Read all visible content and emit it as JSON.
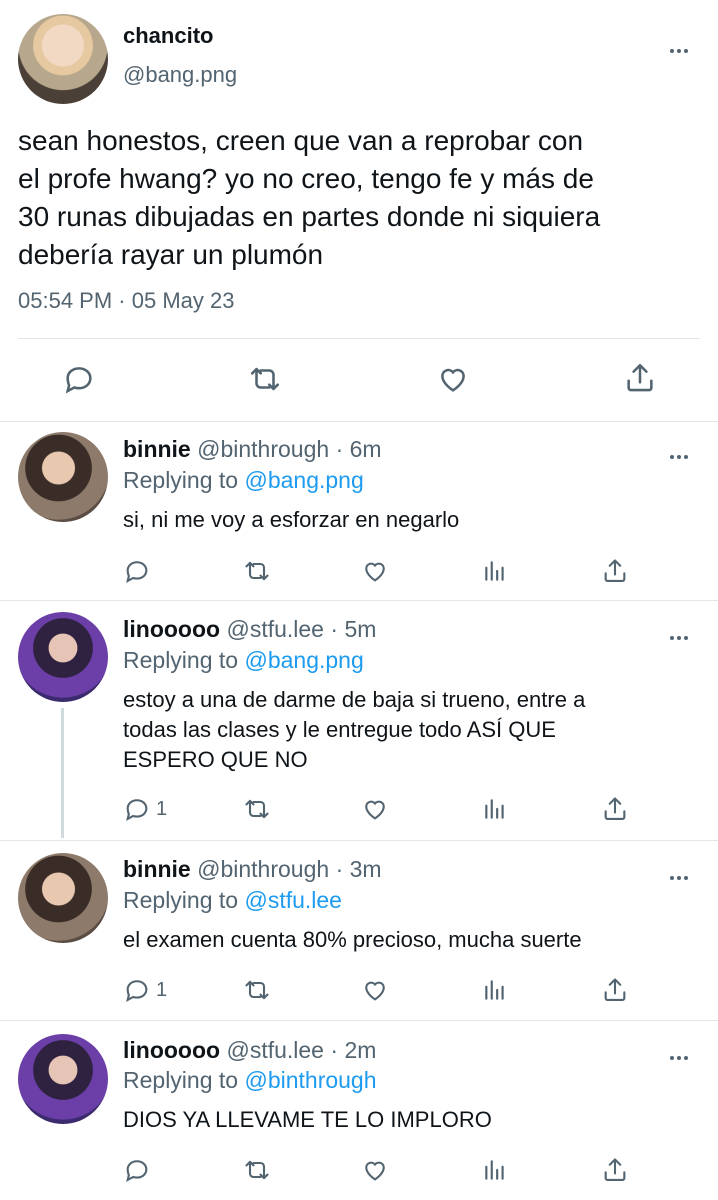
{
  "main_tweet": {
    "display_name": "chancito",
    "handle": "@bang.png",
    "text_lines": [
      "sean honestos, creen que van a reprobar con",
      "el profe hwang? yo no creo, tengo fe y más de",
      "30 runas dibujadas en partes donde ni siquiera",
      "debería rayar un plumón"
    ],
    "time": "05:54 PM",
    "separator": "·",
    "date": "05 May 23",
    "actions": [
      "reply-icon",
      "retweet-icon",
      "like-icon",
      "share-icon"
    ]
  },
  "replies": [
    {
      "display_name": "binnie",
      "handle": "@binthrough",
      "dot": "·",
      "time": "6m",
      "replying_label": "Replying to",
      "replying_to": "@bang.png",
      "text_lines": [
        "si, ni me voy a esforzar en negarlo"
      ],
      "reply_count": ""
    },
    {
      "display_name": "linooooo",
      "handle": "@stfu.lee",
      "dot": "·",
      "time": "5m",
      "replying_label": "Replying to",
      "replying_to": "@bang.png",
      "text_lines": [
        "estoy a una de darme de baja si trueno, entre a",
        "todas las clases y le entregue todo ASÍ QUE",
        "ESPERO QUE NO"
      ],
      "reply_count": "1"
    },
    {
      "display_name": "binnie",
      "handle": "@binthrough",
      "dot": "·",
      "time": "3m",
      "replying_label": "Replying to",
      "replying_to": "@stfu.lee",
      "text_lines": [
        "el examen cuenta 80% precioso, mucha suerte"
      ],
      "reply_count": "1"
    },
    {
      "display_name": "linooooo",
      "handle": "@stfu.lee",
      "dot": "·",
      "time": "2m",
      "replying_label": "Replying to",
      "replying_to": "@binthrough",
      "text_lines": [
        "DIOS YA LLEVAME TE LO IMPLORO"
      ],
      "reply_count": ""
    }
  ],
  "colors": {
    "accent": "#1d9bf0",
    "muted": "#536471",
    "text": "#0f1419"
  }
}
